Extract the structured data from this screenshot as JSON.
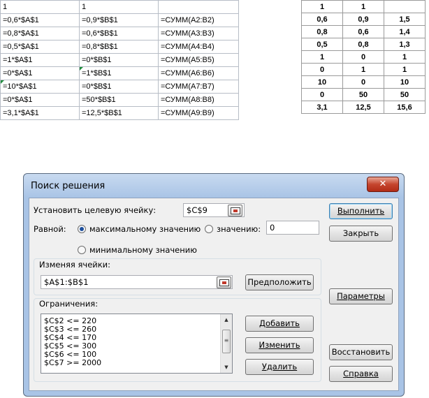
{
  "formula_sheet": {
    "rows": [
      [
        "1",
        "1",
        ""
      ],
      [
        "=0,6*$A$1",
        "=0,9*$B$1",
        "=СУММ(A2:B2)"
      ],
      [
        "=0,8*$A$1",
        "=0,6*$B$1",
        "=СУММ(A3:B3)"
      ],
      [
        "=0,5*$A$1",
        "=0,8*$B$1",
        "=СУММ(A4:B4)"
      ],
      [
        "=1*$A$1",
        "=0*$B$1",
        "=СУММ(A5:B5)"
      ],
      [
        "=0*$A$1",
        "=1*$B$1",
        "=СУММ(A6:B6)"
      ],
      [
        "=10*$A$1",
        "=0*$B$1",
        "=СУММ(A7:B7)"
      ],
      [
        "=0*$A$1",
        "=50*$B$1",
        "=СУММ(A8:B8)"
      ],
      [
        "=3,1*$A$1",
        "=12,5*$B$1",
        "=СУММ(A9:B9)"
      ]
    ]
  },
  "value_sheet": {
    "rows": [
      [
        "1",
        "1",
        ""
      ],
      [
        "0,6",
        "0,9",
        "1,5"
      ],
      [
        "0,8",
        "0,6",
        "1,4"
      ],
      [
        "0,5",
        "0,8",
        "1,3"
      ],
      [
        "1",
        "0",
        "1"
      ],
      [
        "0",
        "1",
        "1"
      ],
      [
        "10",
        "0",
        "10"
      ],
      [
        "0",
        "50",
        "50"
      ],
      [
        "3,1",
        "12,5",
        "15,6"
      ]
    ]
  },
  "dialog": {
    "title": "Поиск решения",
    "close_label": "✕",
    "target_label": "Установить целевую ячейку:",
    "target_value": "$C$9",
    "equal_label": "Равной:",
    "radio_max": "максимальному значению",
    "radio_value": "значению:",
    "value_field": "0",
    "radio_min": "минимальному значению",
    "changing_label": "Изменяя ячейки:",
    "changing_value": "$A$1:$B$1",
    "guess_button": "Предположить",
    "constraints_label": "Ограничения:",
    "constraints": [
      "$C$2 <= 220",
      "$C$3 <= 260",
      "$C$4 <= 170",
      "$C$5 <= 300",
      "$C$6 <= 100",
      "$C$7 >= 2000"
    ],
    "add_button": "Добавить",
    "change_button": "Изменить",
    "delete_button": "Удалить",
    "solve_button": "Выполнить",
    "close_button": "Закрыть",
    "options_button": "Параметры",
    "reset_button": "Восстановить",
    "help_button": "Справка"
  },
  "colors": {
    "title_bar": "#a9c4e6",
    "close_red": "#c5452e",
    "error_marker": "#1f8c3c"
  }
}
